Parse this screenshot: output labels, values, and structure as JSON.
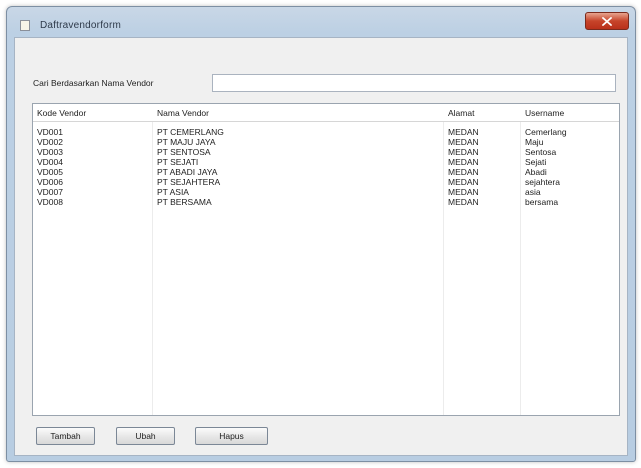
{
  "window": {
    "title": "Daftravendorform"
  },
  "search": {
    "label": "Cari Berdasarkan Nama Vendor",
    "value": ""
  },
  "table": {
    "columns": [
      "Kode Vendor",
      "Nama Vendor",
      "Alamat",
      "Username"
    ],
    "rows": [
      [
        "VD001",
        "PT CEMERLANG",
        "MEDAN",
        "Cemerlang"
      ],
      [
        "VD002",
        "PT MAJU JAYA",
        "MEDAN",
        "Maju"
      ],
      [
        "VD003",
        "PT SENTOSA",
        "MEDAN",
        "Sentosa"
      ],
      [
        "VD004",
        "PT SEJATI",
        "MEDAN",
        "Sejati"
      ],
      [
        "VD005",
        "PT ABADI JAYA",
        "MEDAN",
        "Abadi"
      ],
      [
        "VD006",
        "PT SEJAHTERA",
        "MEDAN",
        "sejahtera"
      ],
      [
        "VD007",
        "PT ASIA",
        "MEDAN",
        "asia"
      ],
      [
        "VD008",
        "PT BERSAMA",
        "MEDAN",
        "bersama"
      ]
    ]
  },
  "buttons": {
    "add": "Tambah",
    "edit": "Ubah",
    "delete": "Hapus"
  },
  "icons": {
    "app": "form-icon",
    "close": "close-icon"
  },
  "colors": {
    "close_button": "#c7442a",
    "window_frame": "#bcd0e4"
  }
}
